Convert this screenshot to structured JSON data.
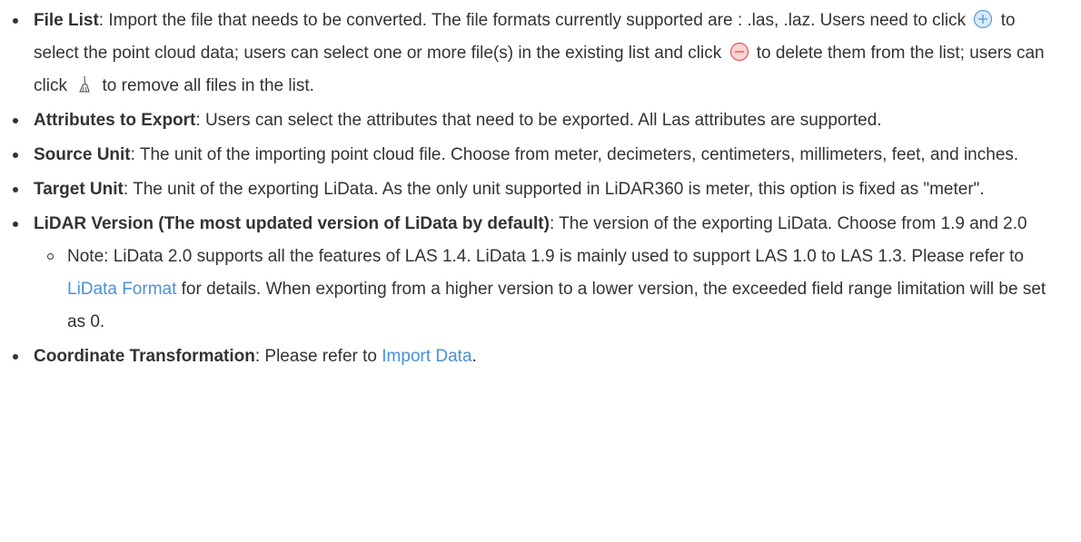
{
  "items": [
    {
      "term": "File List",
      "t1": ": Import the file that needs to be converted. The file formats currently supported are : .las, .laz. Users need to click ",
      "icon1": "add-circle-icon",
      "t2": " to select the point cloud data; users can select one or more file(s) in the existing list and click ",
      "icon2": "remove-circle-icon",
      "t3": " to delete them from the list; users can click ",
      "icon3": "broom-icon",
      "t4": " to remove all files in the list."
    },
    {
      "term": "Attributes to Export",
      "text": ": Users can select the attributes that need to be exported. All Las attributes are supported."
    },
    {
      "term": "Source Unit",
      "text": ": The unit of the importing point cloud file. Choose from meter, decimeters, centimeters, millimeters, feet, and inches."
    },
    {
      "term": "Target Unit",
      "text": ": The unit of the exporting LiData. As the only unit supported in LiDAR360 is meter, this option is fixed as \"meter\"."
    },
    {
      "term": "LiDAR Version (The most updated version of LiData by default)",
      "text": ": The version of the exporting LiData. Choose from 1.9 and 2.0",
      "note": {
        "t1": "Note: LiData 2.0 supports all the features of LAS 1.4. LiData 1.9 is mainly used to support LAS 1.0 to LAS 1.3. Please refer to ",
        "link": "LiData Format",
        "t2": " for details. When exporting from a higher version to a lower version, the exceeded field range limitation will be set as 0."
      }
    },
    {
      "term": "Coordinate Transformation",
      "t1": ": Please refer to ",
      "link": "Import Data",
      "t2": "."
    }
  ],
  "colors": {
    "text": "#333333",
    "link": "#4a90d9",
    "add_icon": "#5b9bd5",
    "remove_icon": "#e05a5a"
  }
}
